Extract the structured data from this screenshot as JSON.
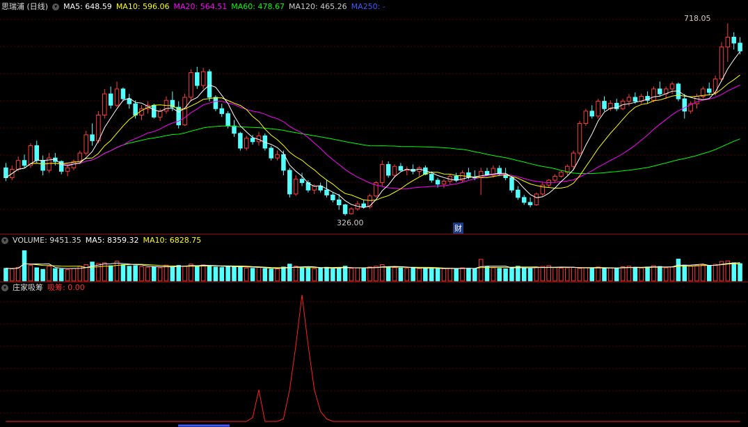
{
  "header": {
    "title": "思瑞浦 (日线)",
    "ma5": "MA5: 648.59",
    "ma10": "MA10: 596.06",
    "ma20": "MA20: 564.51",
    "ma60": "MA60: 478.67",
    "ma120": "MA120: 465.26",
    "ma250": "MA250: -"
  },
  "volume_legend": {
    "title": "VOLUME: 9451.35",
    "ma5": "MA5: 8359.32",
    "ma10": "MA10: 6828.75"
  },
  "indicator_legend": {
    "title": "庄家吸筹",
    "value": "吸筹: 0.00"
  },
  "annotations": {
    "high": "718.05",
    "low": "326.00",
    "event": "财"
  },
  "colors": {
    "up": "#ff3c3c",
    "down": "#54ffff",
    "ma5": "#ffffff",
    "ma10": "#ffff00",
    "ma20": "#ff00ff",
    "ma60": "#00ff00",
    "ma120": "#aaaaaa",
    "ma250": "#3c5aff",
    "indicator": "#ff2020"
  },
  "chart_data": {
    "type": "candlestick",
    "price_range": [
      300,
      740
    ],
    "candles_ohlc": [
      [
        425,
        435,
        398,
        405
      ],
      [
        405,
        430,
        400,
        422
      ],
      [
        422,
        448,
        418,
        440
      ],
      [
        440,
        452,
        425,
        430
      ],
      [
        430,
        475,
        425,
        470
      ],
      [
        470,
        480,
        435,
        440
      ],
      [
        440,
        450,
        410,
        420
      ],
      [
        420,
        455,
        415,
        445
      ],
      [
        445,
        455,
        430,
        438
      ],
      [
        438,
        440,
        412,
        418
      ],
      [
        418,
        432,
        408,
        425
      ],
      [
        425,
        442,
        420,
        438
      ],
      [
        438,
        460,
        432,
        455
      ],
      [
        455,
        500,
        450,
        492
      ],
      [
        492,
        515,
        470,
        480
      ],
      [
        480,
        540,
        475,
        532
      ],
      [
        532,
        585,
        525,
        575
      ],
      [
        575,
        590,
        545,
        552
      ],
      [
        552,
        600,
        548,
        585
      ],
      [
        585,
        588,
        560,
        565
      ],
      [
        565,
        575,
        545,
        555
      ],
      [
        555,
        562,
        525,
        532
      ],
      [
        532,
        552,
        522,
        545
      ],
      [
        545,
        560,
        535,
        552
      ],
      [
        552,
        555,
        525,
        528
      ],
      [
        528,
        545,
        520,
        540
      ],
      [
        540,
        570,
        535,
        562
      ],
      [
        562,
        580,
        540,
        548
      ],
      [
        548,
        560,
        505,
        512
      ],
      [
        512,
        575,
        510,
        568
      ],
      [
        568,
        625,
        560,
        618
      ],
      [
        618,
        630,
        585,
        592
      ],
      [
        592,
        628,
        585,
        620
      ],
      [
        620,
        625,
        560,
        568
      ],
      [
        568,
        572,
        540,
        545
      ],
      [
        545,
        555,
        528,
        535
      ],
      [
        535,
        540,
        505,
        510
      ],
      [
        510,
        522,
        488,
        495
      ],
      [
        495,
        498,
        460,
        465
      ],
      [
        465,
        490,
        460,
        485
      ],
      [
        485,
        492,
        472,
        478
      ],
      [
        478,
        498,
        470,
        490
      ],
      [
        490,
        495,
        460,
        465
      ],
      [
        465,
        470,
        440,
        445
      ],
      [
        445,
        460,
        440,
        452
      ],
      [
        452,
        460,
        410,
        420
      ],
      [
        420,
        425,
        365,
        372
      ],
      [
        372,
        410,
        368,
        402
      ],
      [
        402,
        415,
        388,
        395
      ],
      [
        395,
        400,
        375,
        380
      ],
      [
        380,
        392,
        372,
        388
      ],
      [
        388,
        395,
        375,
        380
      ],
      [
        380,
        400,
        365,
        370
      ],
      [
        370,
        375,
        355,
        360
      ],
      [
        360,
        372,
        340,
        350
      ],
      [
        350,
        352,
        328,
        332
      ],
      [
        332,
        345,
        330,
        342
      ],
      [
        342,
        358,
        338,
        352
      ],
      [
        352,
        360,
        342,
        346
      ],
      [
        346,
        372,
        342,
        368
      ],
      [
        368,
        398,
        365,
        395
      ],
      [
        395,
        440,
        388,
        432
      ],
      [
        432,
        438,
        405,
        410
      ],
      [
        410,
        432,
        405,
        428
      ],
      [
        428,
        435,
        418,
        420
      ],
      [
        420,
        428,
        410,
        422
      ],
      [
        422,
        432,
        412,
        418
      ],
      [
        418,
        428,
        408,
        425
      ],
      [
        425,
        430,
        410,
        412
      ],
      [
        412,
        418,
        395,
        400
      ],
      [
        400,
        405,
        385,
        392
      ],
      [
        392,
        402,
        384,
        398
      ],
      [
        398,
        412,
        392,
        408
      ],
      [
        408,
        415,
        396,
        400
      ],
      [
        400,
        420,
        395,
        415
      ],
      [
        415,
        425,
        402,
        406
      ],
      [
        406,
        420,
        400,
        405
      ],
      [
        405,
        425,
        370,
        418
      ],
      [
        418,
        425,
        408,
        410
      ],
      [
        410,
        430,
        405,
        424
      ],
      [
        424,
        430,
        410,
        412
      ],
      [
        412,
        425,
        400,
        405
      ],
      [
        405,
        408,
        375,
        380
      ],
      [
        380,
        388,
        360,
        365
      ],
      [
        365,
        370,
        350,
        355
      ],
      [
        355,
        365,
        345,
        350
      ],
      [
        350,
        375,
        348,
        372
      ],
      [
        372,
        395,
        368,
        390
      ],
      [
        390,
        402,
        385,
        400
      ],
      [
        400,
        412,
        396,
        408
      ],
      [
        408,
        420,
        405,
        416
      ],
      [
        416,
        432,
        410,
        428
      ],
      [
        428,
        460,
        420,
        455
      ],
      [
        455,
        520,
        450,
        515
      ],
      [
        515,
        545,
        510,
        540
      ],
      [
        540,
        552,
        525,
        530
      ],
      [
        530,
        565,
        525,
        560
      ],
      [
        560,
        570,
        540,
        545
      ],
      [
        545,
        562,
        540,
        556
      ],
      [
        556,
        565,
        540,
        545
      ],
      [
        545,
        565,
        542,
        560
      ],
      [
        560,
        575,
        550,
        568
      ],
      [
        568,
        578,
        555,
        560
      ],
      [
        560,
        575,
        555,
        570
      ],
      [
        570,
        580,
        555,
        562
      ],
      [
        562,
        590,
        558,
        585
      ],
      [
        585,
        600,
        570,
        575
      ],
      [
        575,
        590,
        565,
        585
      ],
      [
        585,
        600,
        575,
        595
      ],
      [
        595,
        598,
        560,
        565
      ],
      [
        565,
        575,
        525,
        540
      ],
      [
        540,
        560,
        535,
        555
      ],
      [
        555,
        575,
        545,
        570
      ],
      [
        570,
        590,
        565,
        585
      ],
      [
        585,
        598,
        572,
        578
      ],
      [
        578,
        612,
        572,
        605
      ],
      [
        605,
        680,
        600,
        670
      ],
      [
        670,
        718,
        640,
        690
      ],
      [
        690,
        700,
        665,
        678
      ],
      [
        678,
        690,
        655,
        662
      ]
    ],
    "volume_range": [
      0,
      14000
    ],
    "volume": [
      4800,
      4600,
      5200,
      11500,
      6000,
      5000,
      4400,
      5600,
      4700,
      4500,
      4300,
      4700,
      5600,
      6200,
      7200,
      6600,
      6900,
      5800,
      7500,
      6200,
      5600,
      5800,
      5400,
      5200,
      5400,
      5000,
      6000,
      5400,
      5900,
      5700,
      6400,
      5600,
      6100,
      5800,
      5300,
      5100,
      5700,
      5400,
      5600,
      4900,
      4800,
      5200,
      4700,
      4500,
      4600,
      5300,
      6400,
      5600,
      4900,
      5100,
      4700,
      4900,
      5200,
      4600,
      5000,
      5600,
      4800,
      5000,
      4700,
      5300,
      5600,
      6200,
      5400,
      5100,
      4900,
      4800,
      5000,
      4700,
      4900,
      4800,
      4600,
      4700,
      4800,
      4600,
      5000,
      4800,
      4600,
      8200,
      5400,
      5000,
      4800,
      4600,
      5200,
      5600,
      4900,
      4700,
      5100,
      5500,
      5800,
      5100,
      4900,
      5000,
      5200,
      4800,
      5000,
      4700,
      5300,
      4800,
      5000,
      4800,
      5400,
      5600,
      5200,
      4900,
      5300,
      5800,
      5500,
      5000,
      5300,
      8300,
      6000,
      5600,
      5900,
      6100,
      5800,
      6300,
      7400,
      7600,
      6900,
      6600
    ],
    "indicator_range": [
      0,
      100
    ],
    "indicator": [
      0,
      0,
      0,
      0,
      0,
      0,
      0,
      0,
      0,
      0,
      0,
      0,
      0,
      0,
      0,
      0,
      0,
      0,
      0,
      0,
      0,
      0,
      0,
      0,
      0,
      0,
      0,
      0,
      0,
      0,
      0,
      0,
      0,
      0,
      0,
      0,
      0,
      0,
      0,
      0,
      3,
      25,
      0,
      0,
      0,
      2,
      25,
      60,
      100,
      60,
      25,
      8,
      2,
      0,
      0,
      0,
      0,
      0,
      0,
      0,
      0,
      0,
      0,
      0,
      0,
      0,
      0,
      0,
      0,
      0,
      0,
      0,
      0,
      0,
      0,
      0,
      0,
      0,
      0,
      0,
      0,
      0,
      0,
      0,
      0,
      0,
      0,
      0,
      0,
      0,
      0,
      0,
      0,
      0,
      0,
      0,
      0,
      0,
      0,
      0,
      0,
      0,
      0,
      0,
      0,
      0,
      0,
      0,
      0,
      0,
      0,
      0,
      0,
      0,
      0,
      0,
      0,
      0,
      0,
      0
    ]
  }
}
